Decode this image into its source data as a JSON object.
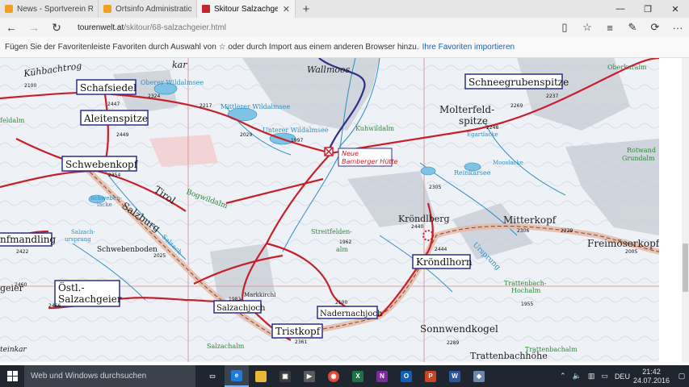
{
  "browser": {
    "tabs": [
      {
        "title": "News - Sportverein Reith - I",
        "color": "#f0a020"
      },
      {
        "title": "Ortsinfo Administration - Be",
        "color": "#f0a020"
      },
      {
        "title": "Skitour Salzachgeier, Tir",
        "color": "#c0282d"
      }
    ],
    "address": {
      "host": "tourenwelt.at",
      "path": "/skitour/68-salzachgeier.html"
    },
    "favorites_hint": "Fügen Sie der Favoritenleiste Favoriten durch Auswahl von ☆ oder durch Import aus einem anderen Browser hinzu.",
    "favorites_link": "Ihre Favoriten importieren"
  },
  "map": {
    "boxed_labels": [
      {
        "id": "schafsiedel",
        "text": "Schafsiedel"
      },
      {
        "id": "aleitenspitze",
        "text": "Aleitenspitze"
      },
      {
        "id": "schwebenkopf",
        "text": "Schwebenkopf"
      },
      {
        "id": "schneegrubenspitze",
        "text": "Schneegrubenspitze"
      },
      {
        "id": "krondlhorn",
        "text": "Kröndlhorn"
      },
      {
        "id": "ostl",
        "text": "Östl.-"
      },
      {
        "id": "salzachgeier",
        "text": "Salzachgeier"
      },
      {
        "id": "salzachjoch",
        "text": "Salzachjoch"
      },
      {
        "id": "nadernachjoch",
        "text": "Nadernachjoch"
      },
      {
        "id": "tristkopf",
        "text": "Tristkopf"
      },
      {
        "id": "mandling",
        "text": "nfmandling"
      }
    ],
    "hut": {
      "line1": "Neue",
      "line2": "Bamberger Hütte"
    },
    "plain_labels": {
      "kuhbachtrog": "Kühbachtrog",
      "kar": "kar",
      "oberer_wildalmsee": "Oberer Wildalmsee",
      "mittlerer_wildalmsee": "Mittlerer Wildalmsee",
      "unterer_wildalmsee": "Unterer Wildalmsee",
      "wallmoos": "Wallmoos",
      "kuhwildalm": "Kuhwildalm",
      "oberkaralm": "Oberkaralm",
      "molterfeld1": "Molterfeld-",
      "molterfeld2": "spitze",
      "egartlacke": "Egartlacke",
      "mooslacke": "Mooslacke",
      "reinkarsee": "Reinkarsee",
      "rotwand1": "Rotwand",
      "rotwand2": "Grundalm",
      "feldalm": "feldalm",
      "schwebenlacke": "Schweben-",
      "schwebenlacke2": "lacke",
      "tirol": "Tirol",
      "salzburg": "Salzburg",
      "bogwildalm": "Bogwildalm",
      "salzach": "Salzach",
      "salzachursprung1": "Salzach-",
      "salzachursprung2": "ursprung",
      "schwebenboden": "Schwebenboden",
      "streitfelden1": "Streitfelden-",
      "streitfelden2": "alm",
      "krondlberg": "Kröndlberg",
      "mitterkopf": "Mitterkopf",
      "freimoserkopf": "Freimöserkopf",
      "ursprung": "Ursprung",
      "trattenbach1": "Trattenbach-",
      "trattenbach2": "Hochalm",
      "sonnwendkogel": "Sonnwendkogel",
      "trattenbachhohe": "Trattenbachhöhe",
      "trattenbachalm": "Trattenbachalm",
      "salzachalm": "Salzachalm",
      "marksirchl": "Markkirchl",
      "geier": "geier",
      "teinkar": "teinkar"
    },
    "elevations": [
      "2447",
      "2324",
      "2449",
      "2217",
      "2029",
      "1997",
      "2237",
      "2269",
      "2248",
      "2354",
      "2305",
      "2440",
      "2444",
      "2306",
      "2229",
      "2005",
      "1962",
      "2025",
      "2422",
      "2460",
      "2466",
      "1983",
      "2100",
      "2361",
      "2289",
      "1955",
      "2100"
    ]
  },
  "taskbar": {
    "search_placeholder": "Web und Windows durchsuchen",
    "apps": [
      {
        "name": "task-view",
        "label": "▭",
        "color": "#00000000"
      },
      {
        "name": "edge",
        "label": "e",
        "color": "#1e7bd8"
      },
      {
        "name": "explorer",
        "label": "▬",
        "color": "#e8b83a"
      },
      {
        "name": "store",
        "label": "▣",
        "color": "#3b3b3b"
      },
      {
        "name": "media",
        "label": "▶",
        "color": "#5a5a5a"
      },
      {
        "name": "chrome",
        "label": "◉",
        "color": "#e04a3a"
      },
      {
        "name": "excel",
        "label": "X",
        "color": "#1e7145"
      },
      {
        "name": "onenote",
        "label": "N",
        "color": "#7a2c9a"
      },
      {
        "name": "outlook",
        "label": "O",
        "color": "#0f5fb6"
      },
      {
        "name": "powerpoint",
        "label": "P",
        "color": "#c94523"
      },
      {
        "name": "word",
        "label": "W",
        "color": "#2b579a"
      },
      {
        "name": "other-app",
        "label": "◆",
        "color": "#6c87a8"
      }
    ],
    "tray": {
      "lang": "DEU",
      "time": "21:42",
      "date": "24.07.2016"
    }
  }
}
